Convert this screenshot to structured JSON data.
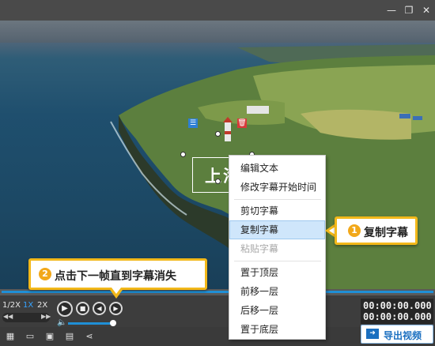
{
  "window": {
    "min_icon": "minimize-icon",
    "restore_icon": "restore-icon",
    "close_icon": "close-icon"
  },
  "video": {
    "subtitle_text": "上海"
  },
  "context_menu": {
    "items": [
      {
        "label": "编辑文本",
        "state": "normal"
      },
      {
        "label": "修改字幕开始时间",
        "state": "normal"
      },
      {
        "label": "剪切字幕",
        "state": "normal"
      },
      {
        "label": "复制字幕",
        "state": "highlighted"
      },
      {
        "label": "粘贴字幕",
        "state": "disabled"
      },
      {
        "label": "置于顶层",
        "state": "normal"
      },
      {
        "label": "前移一层",
        "state": "normal"
      },
      {
        "label": "后移一层",
        "state": "normal"
      },
      {
        "label": "置于底层",
        "state": "normal"
      }
    ]
  },
  "callouts": {
    "step1": {
      "number": "1",
      "text": "复制字幕"
    },
    "step2": {
      "number": "2",
      "text": "点击下一帧直到字幕消失"
    }
  },
  "player": {
    "speeds": [
      "1/2X",
      "1X",
      "2X"
    ],
    "active_speed": "1X",
    "current_time": "00:00:00.000",
    "total_time": "00:00:00.000"
  },
  "toolbar": {
    "export_label": "导出视频"
  },
  "colors": {
    "accent": "#1f8fd6",
    "callout_border": "#f2b81a",
    "menu_highlight": "#cfe6fb"
  }
}
